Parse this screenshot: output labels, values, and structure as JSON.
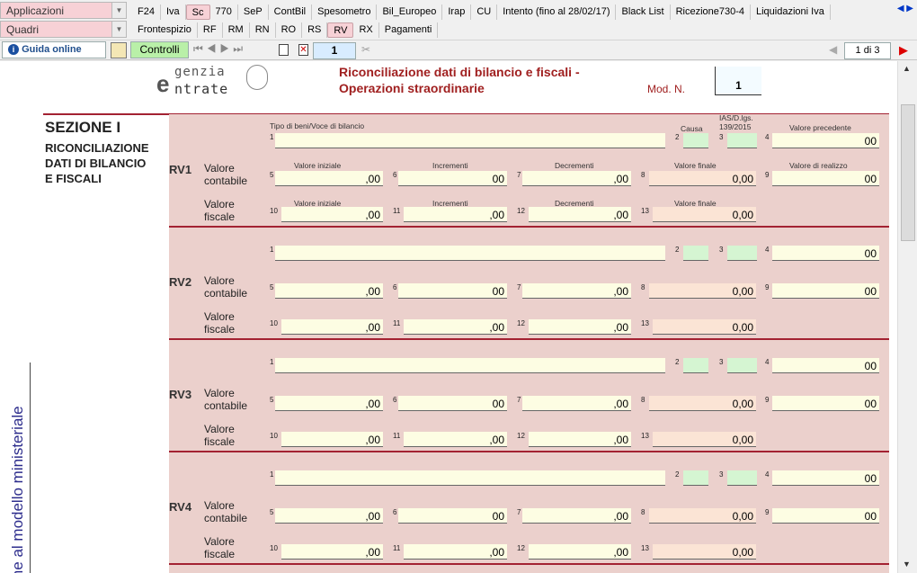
{
  "menu": {
    "applicazioni": "Applicazioni",
    "quadri": "Quadri"
  },
  "tabs_top": [
    "F24",
    "Iva",
    "Sc",
    "770",
    "SeP",
    "ContBil",
    "Spesometro",
    "Bil_Europeo",
    "Irap",
    "CU",
    "Intento (fino al 28/02/17)",
    "Black List",
    "Ricezione730-4",
    "Liquidazioni Iva"
  ],
  "tabs_bottom": [
    "Frontespizio",
    "RF",
    "RM",
    "RN",
    "RO",
    "RS",
    "RV",
    "RX",
    "Pagamenti"
  ],
  "toolbar": {
    "guida": "Guida online",
    "controlli": "Controlli",
    "page_input": "1",
    "page_count": "1 di 3"
  },
  "header": {
    "logo_line1": "genzia",
    "logo_line2": "ntrate",
    "title_line1": "Riconciliazione dati di bilancio e fiscali -",
    "title_line2": "Operazioni straordinarie",
    "mod_label": "Mod. N.",
    "mod_value": "1"
  },
  "section": {
    "title": "SEZIONE I",
    "subtitle": "RICONCILIAZIONE DATI DI BILANCIO E FISCALI"
  },
  "side_text": "orme al modello ministeriale",
  "labels": {
    "tipo": "Tipo di beni/Voce di bilancio",
    "causa": "Causa",
    "ias": "IAS/D.lgs.",
    "ias2": "139/2015",
    "val_prec": "Valore precedente",
    "val_iniz": "Valore iniziale",
    "incr": "Incrementi",
    "decr": "Decrementi",
    "val_fin": "Valore finale",
    "val_real": "Valore di realizzo",
    "vc1": "Valore",
    "vc2": "contabile",
    "vf1": "Valore",
    "vf2": "fiscale"
  },
  "rows": [
    "RV1",
    "RV2",
    "RV3",
    "RV4"
  ],
  "values": {
    "zero": "00",
    "zero_c": ",00",
    "zero_fin": "0,00"
  }
}
